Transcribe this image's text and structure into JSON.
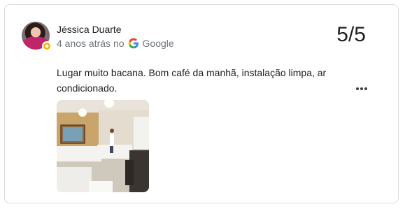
{
  "review": {
    "author": "Jéssica Duarte",
    "time_ago": "4 anos atrás no",
    "source": "Google",
    "score": "5/5",
    "text": "Lugar muito bacana. Bom café da manhã, instalação limpa, ar condicionado.",
    "photo_icon": "restaurant-interior-photo",
    "more_icon": "more-vert-icon",
    "badge_icon": "local-guide-badge-icon"
  }
}
